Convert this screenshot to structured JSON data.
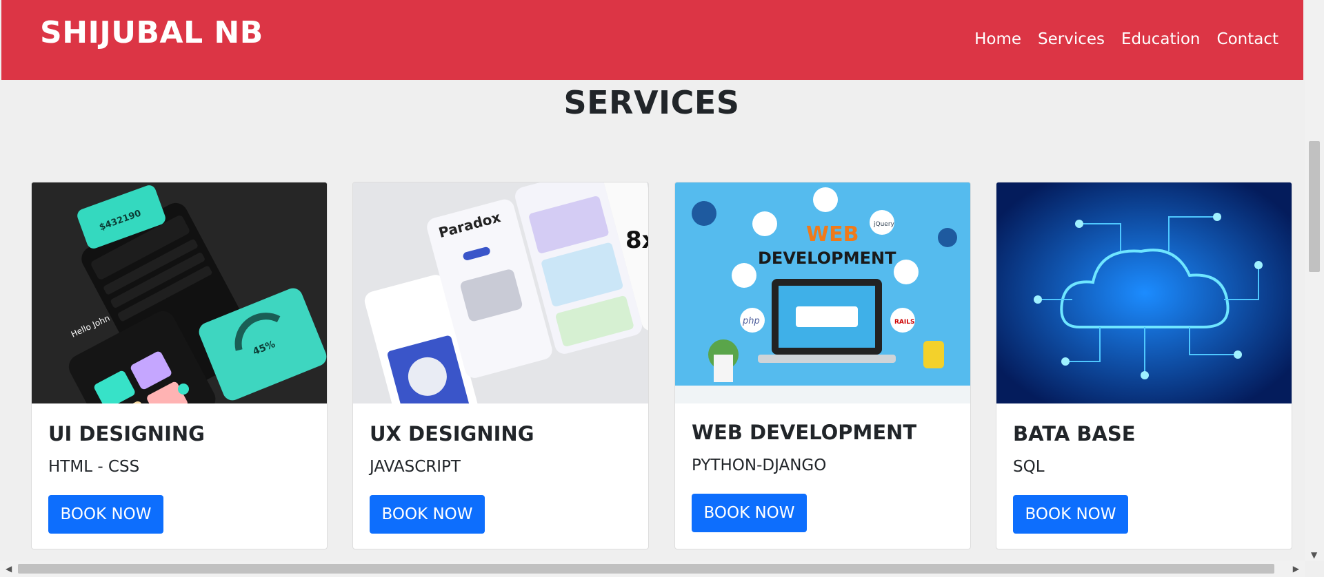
{
  "brand": "SHIJUBAL NB",
  "nav": [
    "Home",
    "Services",
    "Education",
    "Contact"
  ],
  "section_title": "SERVICES",
  "cards": [
    {
      "title": "UI DESIGNING",
      "text": "HTML - CSS",
      "button": "BOOK NOW",
      "image": "ui-mockup-image"
    },
    {
      "title": "UX DESIGNING",
      "text": "JAVASCRIPT",
      "button": "BOOK NOW",
      "image": "ux-mockup-image"
    },
    {
      "title": "WEB DEVELOPMENT",
      "text": "PYTHON-DJANGO",
      "button": "BOOK NOW",
      "image": "web-development-image"
    },
    {
      "title": "BATA BASE",
      "text": "SQL",
      "button": "BOOK NOW",
      "image": "cloud-network-image"
    }
  ],
  "image_texts": {
    "ui": [
      "$432190",
      "Hello John",
      "45%"
    ],
    "ux": [
      "Paradox",
      "8x"
    ],
    "web": [
      "WEB",
      "DEVELOPMENT",
      "php",
      "jQuery",
      "RAILS"
    ]
  },
  "colors": {
    "navbar": "#dc3545",
    "button": "#0d6efd",
    "background": "#efefef"
  }
}
